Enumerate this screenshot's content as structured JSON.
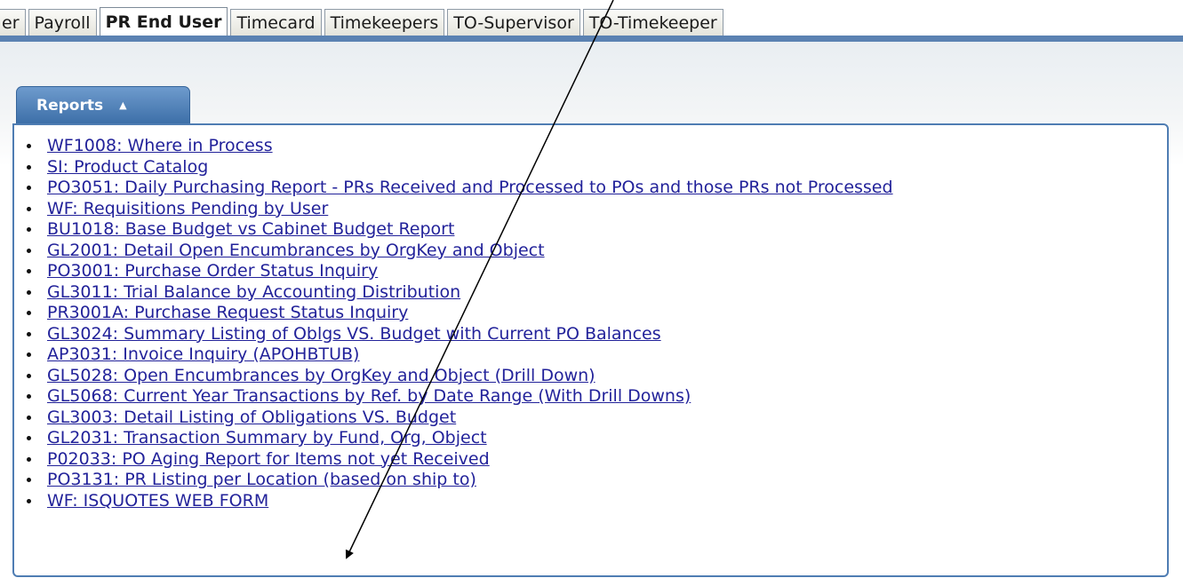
{
  "tabs": [
    {
      "label": "er",
      "active": false
    },
    {
      "label": "Payroll",
      "active": false
    },
    {
      "label": "PR End User",
      "active": true
    },
    {
      "label": "Timecard",
      "active": false
    },
    {
      "label": "Timekeepers",
      "active": false
    },
    {
      "label": "TO-Supervisor",
      "active": false
    },
    {
      "label": "TO-Timekeeper",
      "active": false
    }
  ],
  "portlet": {
    "title": "Reports",
    "collapse_icon": "caret-up-icon"
  },
  "reports": [
    "WF1008: Where in Process",
    "SI: Product Catalog",
    "PO3051: Daily Purchasing Report - PRs Received and Processed to POs and those PRs not Processed",
    "WF: Requisitions Pending by User",
    "BU1018: Base Budget vs Cabinet Budget Report",
    "GL2001: Detail Open Encumbrances by OrgKey and Object",
    "PO3001: Purchase Order Status Inquiry",
    "GL3011: Trial Balance by Accounting Distribution",
    "PR3001A: Purchase Request Status Inquiry",
    "GL3024: Summary Listing of Oblgs VS. Budget with Current PO Balances",
    "AP3031: Invoice Inquiry (APOHBTUB)",
    "GL5028: Open Encumbrances by OrgKey and Object (Drill Down)",
    "GL5068: Current Year Transactions by Ref. by Date Range (With Drill Downs)",
    "GL3003: Detail Listing of Obligations VS. Budget",
    "GL2031: Transaction Summary by Fund, Org, Object",
    "P02033: PO Aging Report for Items not yet Received",
    "PO3131: PR Listing per Location (based on ship to)",
    "WF: ISQUOTES WEB FORM"
  ],
  "colors": {
    "link": "#22229a",
    "accent": "#4f7db3",
    "tab_rule": "#5b82b2"
  },
  "annotation": {
    "type": "arrow",
    "points_to": "WF: ISQUOTES WEB FORM"
  }
}
